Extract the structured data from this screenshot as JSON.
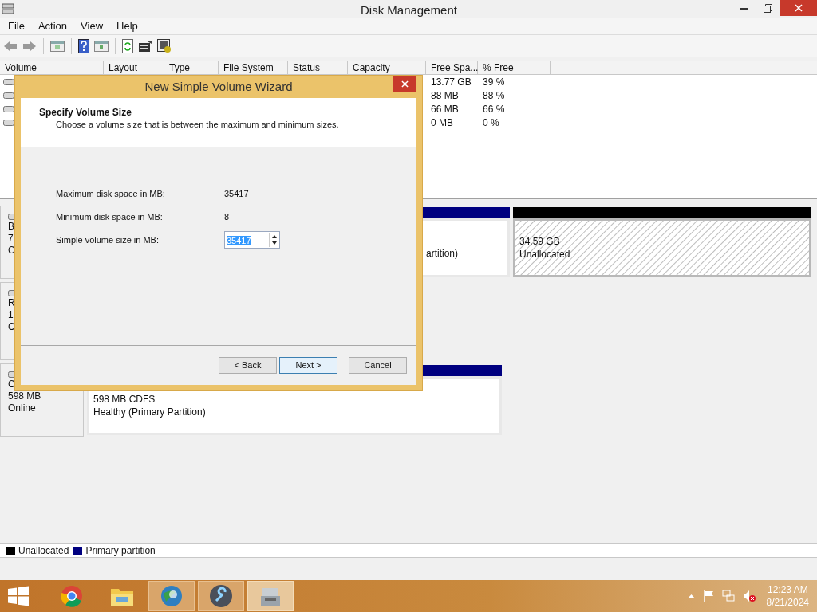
{
  "window": {
    "title": "Disk Management"
  },
  "menu": [
    "File",
    "Action",
    "View",
    "Help"
  ],
  "volume_list": {
    "columns": [
      "Volume",
      "Layout",
      "Type",
      "File System",
      "Status",
      "Capacity",
      "Free Spa...",
      "% Free"
    ],
    "rows": [
      {
        "free_space": "13.77 GB",
        "percent_free": "39 %"
      },
      {
        "free_space": "88 MB",
        "percent_free": "88 %"
      },
      {
        "free_space": "66 MB",
        "percent_free": "66 %"
      },
      {
        "free_space": "0 MB",
        "percent_free": "0 %"
      }
    ]
  },
  "disks": [
    {
      "label_lines": [
        "B",
        "7",
        "C"
      ],
      "partitions": [
        {
          "kind": "primary",
          "lines": [
            "artition)"
          ]
        },
        {
          "kind": "unallocated",
          "lines": [
            "34.59 GB",
            "Unallocated"
          ]
        }
      ]
    },
    {
      "label_lines": [
        "R",
        "1",
        "C"
      ]
    },
    {
      "label_lines": [
        "C",
        "598 MB",
        "Online"
      ],
      "partitions": [
        {
          "kind": "primary",
          "lines": [
            "598 MB CDFS",
            "Healthy (Primary Partition)"
          ]
        }
      ]
    }
  ],
  "legend": [
    {
      "label": "Unallocated",
      "color": "#000000"
    },
    {
      "label": "Primary partition",
      "color": "#000080"
    }
  ],
  "dialog": {
    "title": "New Simple Volume Wizard",
    "heading": "Specify Volume Size",
    "subheading": "Choose a volume size that is between the maximum and minimum sizes.",
    "fields": [
      {
        "kind": "text",
        "label": "Maximum disk space in MB:",
        "value": "35417"
      },
      {
        "kind": "text",
        "label": "Minimum disk space in MB:",
        "value": "8"
      },
      {
        "kind": "spinner",
        "label": "Simple volume size in MB:",
        "value": "35417"
      }
    ],
    "buttons": [
      {
        "label": "< Back",
        "selected": false
      },
      {
        "label": "Next >",
        "selected": true
      },
      {
        "label": "Cancel",
        "selected": false
      }
    ]
  },
  "taskbar": {
    "time": "12:23 AM",
    "date": "8/21/2024"
  }
}
